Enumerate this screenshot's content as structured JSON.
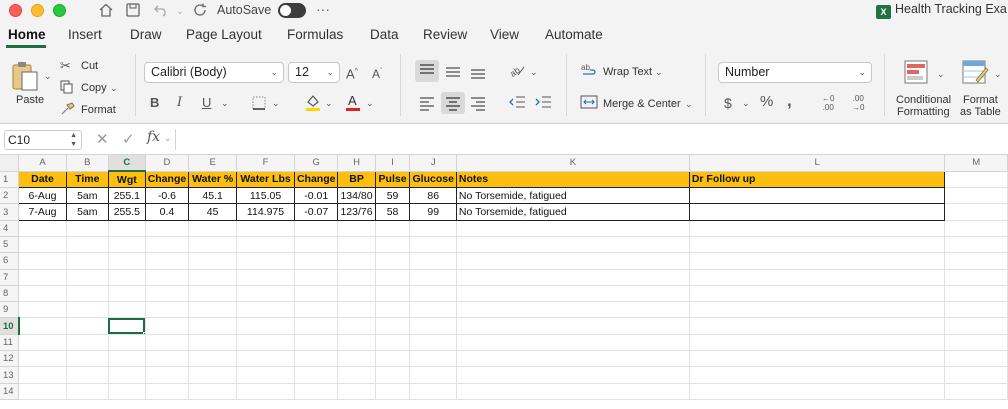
{
  "window": {
    "autosave_label": "AutoSave",
    "title": "Health Tracking Exa",
    "more_label": "···"
  },
  "tabs": [
    "Home",
    "Insert",
    "Draw",
    "Page Layout",
    "Formulas",
    "Data",
    "Review",
    "View",
    "Automate"
  ],
  "ribbon": {
    "paste_label": "Paste",
    "cut_label": "Cut",
    "copy_label": "Copy",
    "format_label": "Format",
    "font_name": "Calibri (Body)",
    "font_size": "12",
    "wrap_text_label": "Wrap Text",
    "merge_center_label": "Merge & Center",
    "number_format": "Number",
    "conditional_formatting_label1": "Conditional",
    "conditional_formatting_label2": "Formatting",
    "format_table_label1": "Format",
    "format_table_label2": "as Table",
    "font_color": "#e02020",
    "highlight_color": "#ffd400"
  },
  "formula_bar": {
    "name_box": "C10",
    "fx_label": "fx",
    "formula": ""
  },
  "grid": {
    "columns": [
      "A",
      "B",
      "C",
      "D",
      "E",
      "F",
      "G",
      "H",
      "I",
      "J",
      "K",
      "L",
      "M"
    ],
    "selected_column": "C",
    "selected_row": "10",
    "rows": [
      "1",
      "2",
      "3",
      "4",
      "5",
      "6",
      "7",
      "8",
      "9",
      "10",
      "11",
      "12",
      "13",
      "14"
    ],
    "header_row": [
      "Date",
      "Time",
      "Wgt",
      "Change",
      "Water %",
      "Water Lbs",
      "Change",
      "BP",
      "Pulse",
      "Glucose",
      "Notes",
      "Dr Follow up"
    ],
    "data_rows": [
      [
        "6-Aug",
        "5am",
        "255.1",
        "-0.6",
        "45.1",
        "115.05",
        "-0.01",
        "134/80",
        "59",
        "86",
        "No Torsemide, fatigued",
        ""
      ],
      [
        "7-Aug",
        "5am",
        "255.5",
        "0.4",
        "45",
        "114.975",
        "-0.07",
        "123/76",
        "58",
        "99",
        "No Torsemide, fatigued",
        ""
      ]
    ],
    "header_fill": "#fdbf0f",
    "accent": "#1e6e42"
  }
}
